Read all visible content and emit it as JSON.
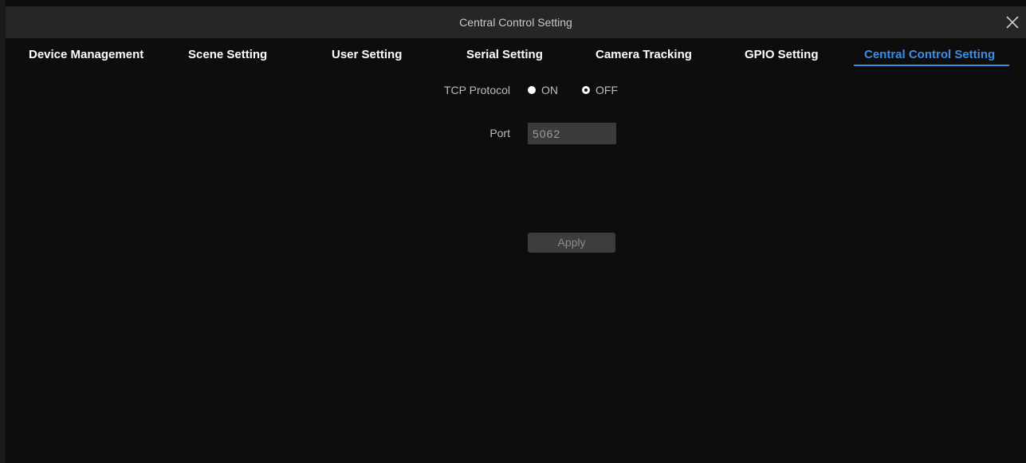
{
  "window": {
    "title": "Central Control Setting",
    "close_icon": "close-icon"
  },
  "tabs": [
    {
      "label": "Device Management",
      "active": false
    },
    {
      "label": "Scene Setting",
      "active": false
    },
    {
      "label": "User Setting",
      "active": false
    },
    {
      "label": "Serial Setting",
      "active": false
    },
    {
      "label": "Camera Tracking",
      "active": false
    },
    {
      "label": "GPIO Setting",
      "active": false
    },
    {
      "label": "Central Control Setting",
      "active": true
    }
  ],
  "form": {
    "tcp_protocol": {
      "label": "TCP Protocol",
      "options": [
        {
          "label": "ON",
          "selected": false
        },
        {
          "label": "OFF",
          "selected": true
        }
      ]
    },
    "port": {
      "label": "Port",
      "value": "5062"
    },
    "apply_label": "Apply"
  },
  "colors": {
    "accent": "#3a8ee6",
    "background": "#0d0d0d",
    "titlebar": "#262626"
  }
}
